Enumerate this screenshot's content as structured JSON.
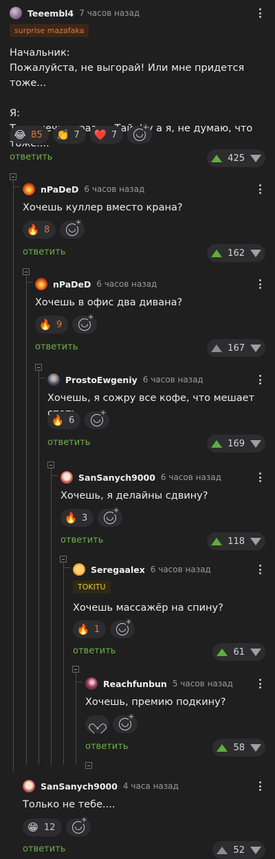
{
  "colors": {
    "background": "#1f1f20",
    "reply_link": "#6fb04a",
    "upvote": "#5fae3d",
    "badge_orange": "#e07a3a",
    "badge_yellow": "#e6c84a"
  },
  "comments": [
    {
      "user": "Teeembl4",
      "time": "7 часов назад",
      "avatar": "purple-avatar",
      "badge": "surprise mazafaka",
      "text": "Начальник:\nПожалуйста, не выгорай! Или мне придется тоже...\n\nЯ:\nТы конечно сразу в Тай. Ну а я, не думаю, что тоже....",
      "reactions": [
        {
          "icon": "laughing-face-icon",
          "emoji": "😂",
          "count": "85"
        },
        {
          "icon": "clapping-hands-icon",
          "emoji": "👏",
          "count": "7"
        },
        {
          "icon": "red-heart-icon",
          "emoji": "❤️",
          "count": "7"
        }
      ],
      "reply": "ответить",
      "score": "425"
    },
    {
      "user": "nPaDeD",
      "time": "6 часов назад",
      "avatar": "fire-avatar",
      "text": "Хочешь куллер вместо крана?",
      "reactions": [
        {
          "icon": "fire-icon",
          "emoji": "🔥",
          "count": "8"
        }
      ],
      "reply": "ответить",
      "score": "162"
    },
    {
      "user": "nPaDeD",
      "time": "6 часов назад",
      "avatar": "fire-avatar",
      "text": "Хочешь в офис два дивана?",
      "reactions": [
        {
          "icon": "fire-icon",
          "emoji": "🔥",
          "count": "9"
        }
      ],
      "reply": "ответить",
      "score": "167"
    },
    {
      "user": "ProstoEwgeniy",
      "time": "6 часов назад",
      "avatar": "photo-avatar",
      "text": "Хочешь, я сожру все кофе, что мешает спать",
      "reactions": [
        {
          "icon": "fire-icon",
          "emoji": "🔥",
          "count": "6"
        }
      ],
      "reply": "ответить",
      "score": "169"
    },
    {
      "user": "SanSanych9000",
      "time": "6 часов назад",
      "avatar": "cartoon-avatar",
      "text": "Хочешь, я делайны сдвину?",
      "reactions": [
        {
          "icon": "fire-icon",
          "emoji": "🔥",
          "count": "3"
        }
      ],
      "reply": "ответить",
      "score": "118"
    },
    {
      "user": "Seregaalex",
      "time": "6 часов назад",
      "avatar": "smiley-avatar",
      "badge": "TOKITU",
      "text": "Хочешь массажёр на спину?",
      "reactions": [
        {
          "icon": "fire-icon",
          "emoji": "🔥",
          "count": "1"
        }
      ],
      "reply": "ответить",
      "score": "61"
    },
    {
      "user": "Reachfunbun",
      "time": "5 часов назад",
      "avatar": "photo-avatar",
      "text": "Хочешь, премию подкину?",
      "reactions": [],
      "reply": "ответить",
      "score": "58"
    },
    {
      "user": "SanSanych9000",
      "time": "4 часа назад",
      "avatar": "cartoon-avatar",
      "text": "Только не тебе....",
      "reactions": [
        {
          "icon": "grinning-face-icon",
          "emoji": "😁",
          "count": "12"
        }
      ],
      "reply": "ответить",
      "score": "52"
    }
  ]
}
